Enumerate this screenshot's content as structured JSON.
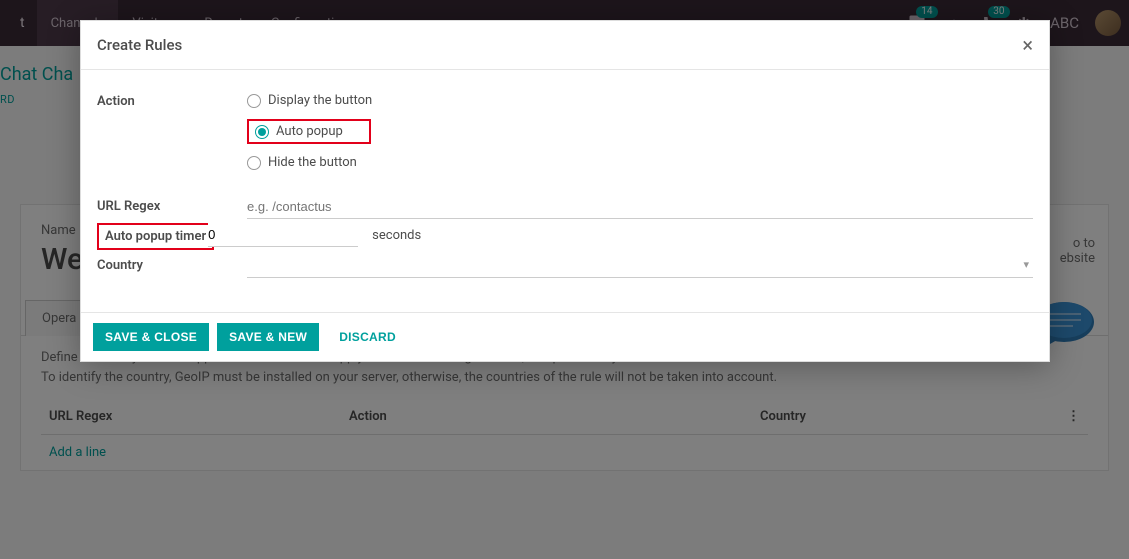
{
  "topnav": {
    "brand": "t",
    "items": [
      "Channels",
      "Visitors",
      "Report",
      "Configuration"
    ],
    "notifications": {
      "chat_count": "14",
      "call_count": "30"
    },
    "user_label": "ABC"
  },
  "page": {
    "title": "Chat Cha",
    "sub": "RD",
    "goto_text_line1": "o to",
    "goto_text_line2": "ebsite",
    "name_label": "Name",
    "name_value": "Wel",
    "tab_label": "Opera",
    "rules_desc_line1": "Define rules for your live support channel. You can apply an action for the given URL, and per country.",
    "rules_desc_line2": "To identify the country, GeoIP must be installed on your server, otherwise, the countries of the rule will not be taken into account.",
    "table": {
      "col_url": "URL Regex",
      "col_action": "Action",
      "col_country": "Country",
      "add_line": "Add a line"
    }
  },
  "modal": {
    "title": "Create Rules",
    "labels": {
      "action": "Action",
      "url_regex": "URL Regex",
      "auto_popup_timer": "Auto popup timer",
      "country": "Country",
      "seconds": "seconds"
    },
    "radios": {
      "display": "Display the button",
      "auto_popup": "Auto popup",
      "hide": "Hide the button"
    },
    "url_placeholder": "e.g. /contactus",
    "timer_value": "0",
    "footer": {
      "save_close": "SAVE & CLOSE",
      "save_new": "SAVE & NEW",
      "discard": "DISCARD"
    }
  }
}
